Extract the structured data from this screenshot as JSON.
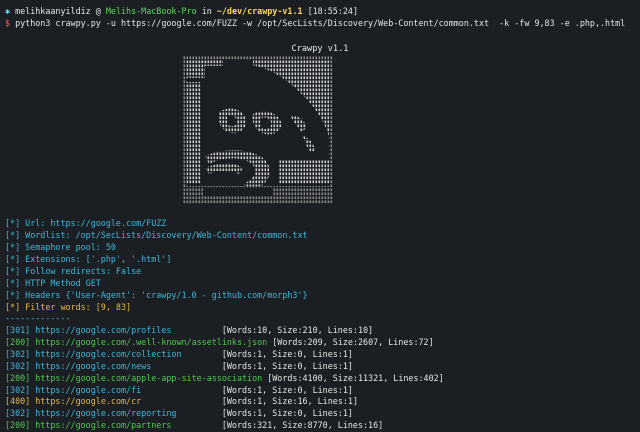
{
  "prompt": {
    "bullet": "✱",
    "user": "melihkaanyildiz",
    "at": "@",
    "host": "Melihs-MacBook-Pro",
    "in": "in",
    "path": "~/dev/crawpy-v1.1",
    "time": "[18:55:24]",
    "dollar": "$",
    "command": "python3 crawpy.py -u https://google.com/FUZZ -w /opt/SecLists/Discovery/Web-Content/common.txt  -k -fw 9,83 -e .php,.html"
  },
  "banner": {
    "title": "Crawpy v1.1",
    "art_description_icon": "crawpy-ascii-logo"
  },
  "config": [
    "[*] Url: https://google.com/FUZZ",
    "[*] Wordlist: /opt/SecLists/Discovery/Web-Content/common.txt",
    "[*] Semaphore pool: 50",
    "[*] Extensions: ['.php', '.html']",
    "[*] Follow redirects: False",
    "[*] HTTP Method GET",
    "[*] Headers {'User-Agent': 'crawpy/1.0 - github.com/morph3'}"
  ],
  "config_last": "[*] Filter words: [9, 83]",
  "separator": "-------------",
  "results": [
    {
      "code": "[301]",
      "cls": "301",
      "url": "https://google.com/profiles",
      "pad": "          ",
      "stats": "[Words:10, Size:210, Lines:10]"
    },
    {
      "code": "[200]",
      "cls": "200",
      "url": "https://google.com/.well-known/assetlinks.json",
      "pad": " ",
      "stats": "[Words:209, Size:2607, Lines:72]"
    },
    {
      "code": "[302]",
      "cls": "302",
      "url": "https://google.com/collection",
      "pad": "        ",
      "stats": "[Words:1, Size:0, Lines:1]"
    },
    {
      "code": "[302]",
      "cls": "302",
      "url": "https://google.com/news",
      "pad": "              ",
      "stats": "[Words:1, Size:0, Lines:1]"
    },
    {
      "code": "[200]",
      "cls": "200",
      "url": "https://google.com/apple-app-site-association",
      "pad": " ",
      "stats": "[Words:4100, Size:11321, Lines:402]"
    },
    {
      "code": "[302]",
      "cls": "302",
      "url": "https://google.com/fi",
      "pad": "                ",
      "stats": "[Words:1, Size:0, Lines:1]"
    },
    {
      "code": "[400]",
      "cls": "400",
      "url": "https://google.com/cr",
      "pad": "                ",
      "stats": "[Words:1, Size:16, Lines:1]"
    },
    {
      "code": "[302]",
      "cls": "302",
      "url": "https://google.com/reporting",
      "pad": "         ",
      "stats": "[Words:1, Size:0, Lines:1]"
    },
    {
      "code": "[200]",
      "cls": "200",
      "url": "https://google.com/partners",
      "pad": "          ",
      "stats": "[Words:321, Size:8770, Lines:16]"
    }
  ],
  "colors": {
    "background": "#1b1f23",
    "info": "#3fb7d8",
    "success": "#4ec94e",
    "warning": "#e6b84a",
    "path": "#ffd75f"
  }
}
